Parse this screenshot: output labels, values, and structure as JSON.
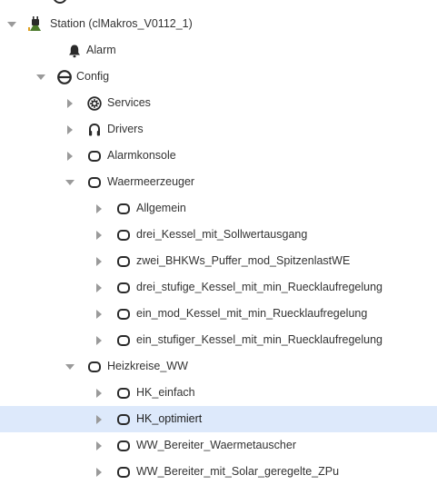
{
  "tree": {
    "station": {
      "label": "Station (clMakros_V0112_1)",
      "icon": "station-plug-icon"
    },
    "alarm": {
      "label": "Alarm",
      "icon": "bell-icon"
    },
    "config": {
      "label": "Config",
      "icon": "database-icon"
    },
    "services": {
      "label": "Services",
      "icon": "gear-circle-icon"
    },
    "drivers": {
      "label": "Drivers",
      "icon": "drivers-icon"
    },
    "alarmkonsole": {
      "label": "Alarmkonsole",
      "icon": "folder-icon"
    },
    "waermeerzeuger": {
      "label": "Waermeerzeuger",
      "icon": "folder-icon",
      "children": [
        {
          "label": "Allgemein"
        },
        {
          "label": "drei_Kessel_mit_Sollwertausgang"
        },
        {
          "label": "zwei_BHKWs_Puffer_mod_SpitzenlastWE"
        },
        {
          "label": "drei_stufige_Kessel_mit_min_Ruecklaufregelung"
        },
        {
          "label": "ein_mod_Kessel_mit_min_Ruecklaufregelung"
        },
        {
          "label": "ein_stufiger_Kessel_mit_min_Ruecklaufregelung"
        }
      ]
    },
    "heizkreise": {
      "label": "Heizkreise_WW",
      "icon": "folder-icon",
      "children": [
        {
          "label": "HK_einfach",
          "selected": false
        },
        {
          "label": "HK_optimiert",
          "selected": true
        },
        {
          "label": "WW_Bereiter_Waermetauscher",
          "selected": false
        },
        {
          "label": "WW_Bereiter_mit_Solar_geregelte_ZPu",
          "selected": false
        }
      ]
    }
  },
  "colors": {
    "selection_bg": "#dde9fb",
    "expander": "#9a9a9a",
    "icon": "#2a2a2a"
  }
}
